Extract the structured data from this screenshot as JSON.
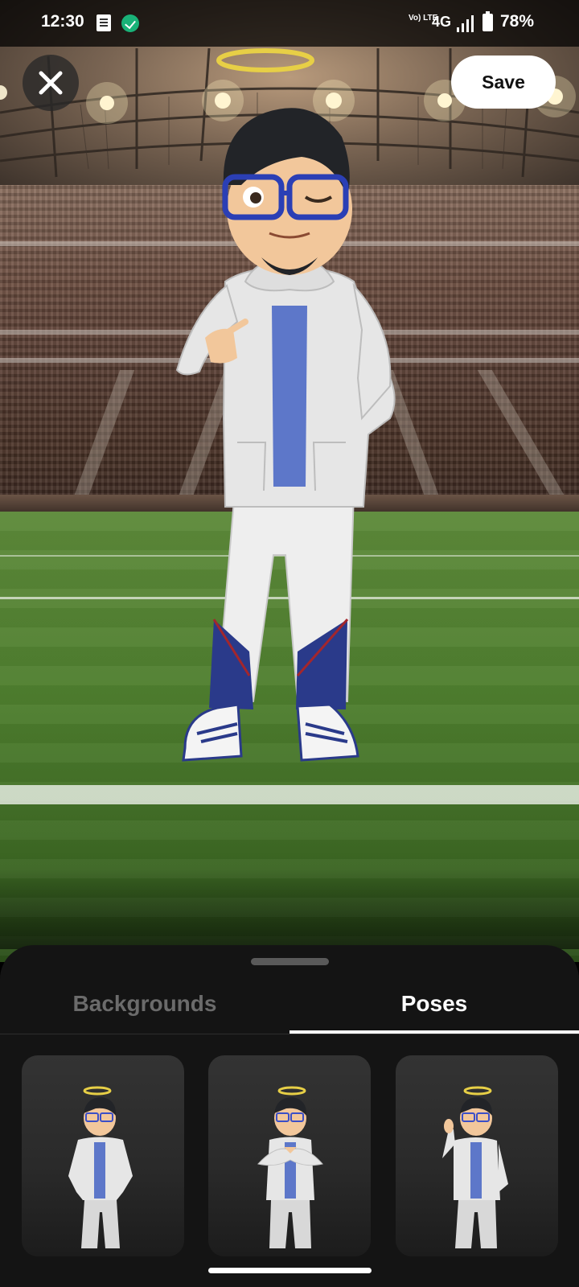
{
  "status_bar": {
    "time": "12:30",
    "network_type": "4G",
    "volte_label": "Vo) LTE",
    "battery": "78%"
  },
  "top_bar": {
    "close_icon": "close-icon",
    "save_label": "Save"
  },
  "sheet": {
    "tabs": [
      {
        "label": "Backgrounds",
        "selected": false
      },
      {
        "label": "Poses",
        "selected": true
      }
    ],
    "pose_cards": [
      {
        "name": "hands-on-hips-pose"
      },
      {
        "name": "heart-hands-pose"
      },
      {
        "name": "waving-pose"
      }
    ]
  },
  "colors": {
    "sheet_bg": "#141414",
    "selected_tab": "#ffffff",
    "unselected_tab": "#6b6b6b",
    "save_button_bg": "#ffffff"
  }
}
